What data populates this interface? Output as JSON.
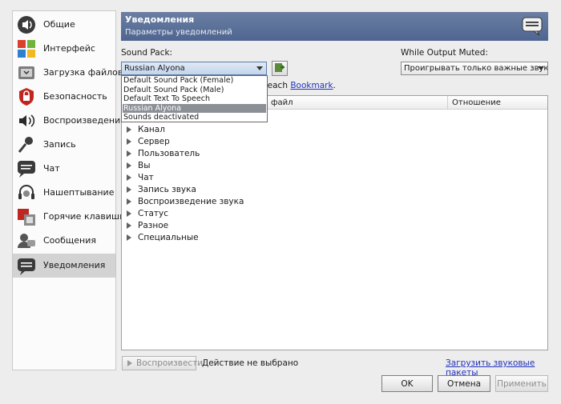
{
  "sidebar": {
    "items": [
      {
        "label": "Общие",
        "icon": "speaker-general-icon"
      },
      {
        "label": "Интерфейс",
        "icon": "windows-interface-icon"
      },
      {
        "label": "Загрузка файлов",
        "icon": "file-transfer-icon"
      },
      {
        "label": "Безопасность",
        "icon": "security-shield-icon"
      },
      {
        "label": "Воспроизведение",
        "icon": "playback-speaker-icon"
      },
      {
        "label": "Запись",
        "icon": "microphone-icon"
      },
      {
        "label": "Чат",
        "icon": "chat-bubble-icon"
      },
      {
        "label": "Нашептывание",
        "icon": "whisper-headset-icon"
      },
      {
        "label": "Горячие клавиши",
        "icon": "hotkeys-icon"
      },
      {
        "label": "Сообщения",
        "icon": "messages-icon"
      },
      {
        "label": "Уведомления",
        "icon": "notifications-icon"
      }
    ],
    "selected_index": 10
  },
  "header": {
    "title": "Уведомления",
    "subtitle": "Параметры уведомлений",
    "icon": "notifications-icon"
  },
  "sound_pack": {
    "label": "Sound Pack:",
    "selected": "Russian Alyona",
    "options": [
      "Default Sound Pack (Female)",
      "Default Sound Pack (Male)",
      "Default Text To Speech",
      "Russian Alyona",
      "Sounds deactivated"
    ],
    "highlighted_index": 3
  },
  "output_muted": {
    "label": "While Output Muted:",
    "selected": "Проигрывать только важные звуки"
  },
  "bookmark_hint": {
    "prefix": "r each ",
    "link": "Bookmark",
    "suffix": "."
  },
  "tree": {
    "columns": [
      "файл",
      "Отношение"
    ],
    "rows": [
      "Канал",
      "Сервер",
      "Пользователь",
      "Вы",
      "Чат",
      "Запись звука",
      "Воспроизведение звука",
      "Статус",
      "Разное",
      "Специальные"
    ]
  },
  "bottom": {
    "play_label": "Воспроизвести",
    "status": "Действие не выбрано",
    "download_link": "Загрузить звуковые пакеты"
  },
  "buttons": {
    "ok": "OK",
    "cancel": "Отмена",
    "apply": "Применить"
  },
  "colors": {
    "header_top": "#6b7fa3",
    "header_bottom": "#4f6590",
    "link": "#2233bb",
    "selected_option": "#8b8f96"
  }
}
